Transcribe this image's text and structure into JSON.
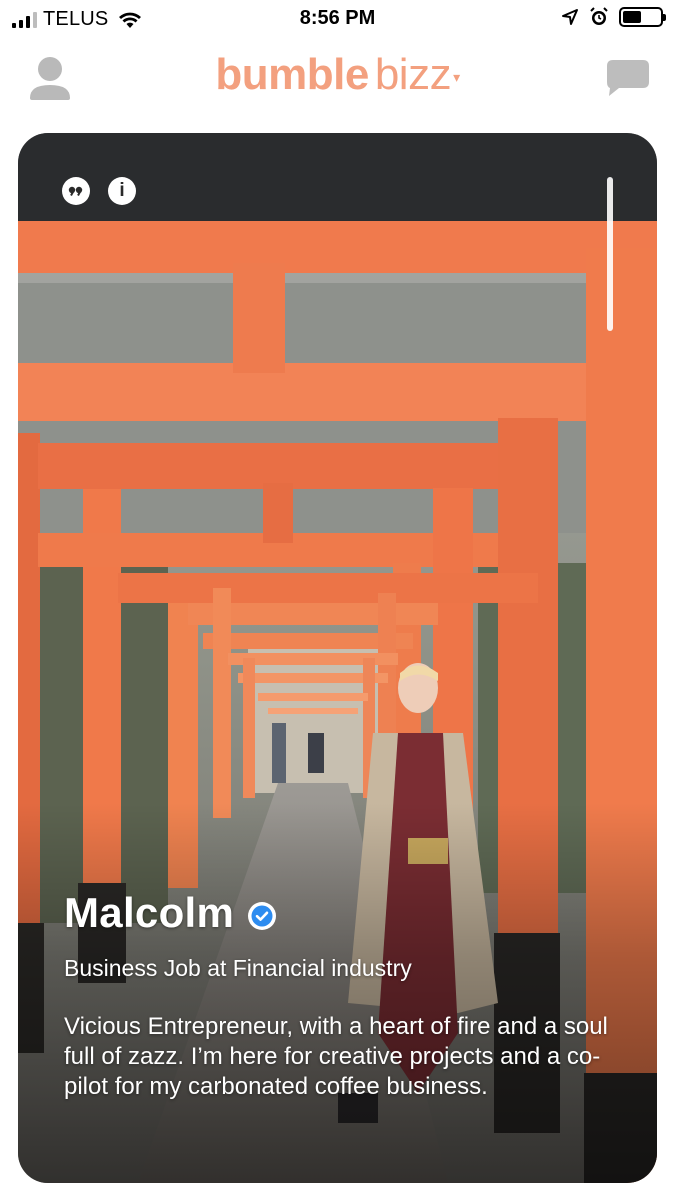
{
  "status_bar": {
    "carrier": "TELUS",
    "time": "8:56 PM"
  },
  "nav": {
    "logo_main": "bumble",
    "logo_sub": "bizz",
    "icons": [
      "profile-icon",
      "chat-icon"
    ]
  },
  "colors": {
    "brand": "#f3a07f",
    "verified": "#2d8cf0",
    "torii": "#f07a4d"
  },
  "card": {
    "icons": [
      "quote-icon",
      "info-icon"
    ],
    "name": "Malcolm",
    "verified": true,
    "job": "Business Job at Financial industry",
    "bio": "Vicious Entrepreneur, with a heart of fire and a soul full of zazz. I’m here for creative projects and a co-pilot for my carbonated coffee business."
  }
}
